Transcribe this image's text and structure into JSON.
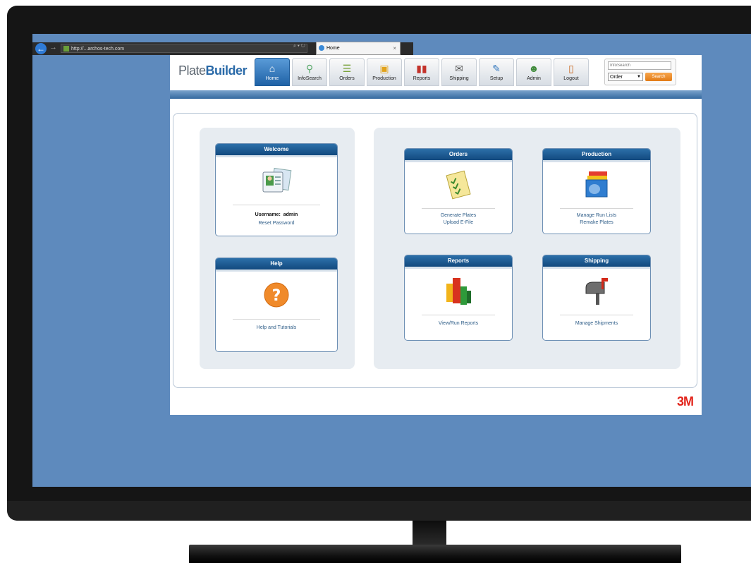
{
  "browser": {
    "url": "http://...archos-tech.com",
    "tab_title": "Home",
    "controls": "⌕ ▾ ↻",
    "close": "×"
  },
  "app": {
    "logo_light": "Plate",
    "logo_bold": "Builder",
    "nav": [
      {
        "label": "Home",
        "icon": "house-icon",
        "active": true
      },
      {
        "label": "InfoSearch",
        "icon": "magnifier-icon"
      },
      {
        "label": "Orders",
        "icon": "orders-icon"
      },
      {
        "label": "Production",
        "icon": "production-icon"
      },
      {
        "label": "Reports",
        "icon": "chart-icon"
      },
      {
        "label": "Shipping",
        "icon": "mailbox-icon"
      },
      {
        "label": "Setup",
        "icon": "setup-icon"
      },
      {
        "label": "Admin",
        "icon": "admin-icon"
      },
      {
        "label": "Logout",
        "icon": "door-icon"
      }
    ],
    "search": {
      "placeholder": "InfoSearch",
      "select_value": "Order",
      "button": "Search"
    },
    "cards": {
      "welcome": {
        "title": "Welcome",
        "username_label": "Username:",
        "username_value": "admin",
        "link": "Reset Password"
      },
      "help": {
        "title": "Help",
        "link": "Help and Tutorials"
      },
      "orders": {
        "title": "Orders",
        "link1": "Generate Plates",
        "link2": "Upload E-File"
      },
      "production": {
        "title": "Production",
        "link1": "Manage Run Lists",
        "link2": "Remake Plates"
      },
      "reports": {
        "title": "Reports",
        "link1": "View/Run Reports"
      },
      "shipping": {
        "title": "Shipping",
        "link1": "Manage Shipments"
      }
    },
    "brand_mark": "3M"
  }
}
